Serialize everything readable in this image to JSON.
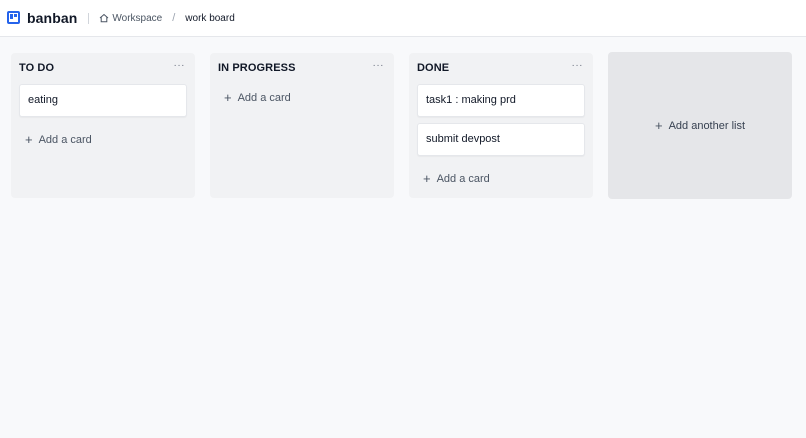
{
  "header": {
    "brand": "banban",
    "logo_icon": "board-icon",
    "breadcrumb": {
      "home_icon": "home-icon",
      "workspace": "Workspace",
      "separator": "/",
      "board": "work board"
    }
  },
  "lists": [
    {
      "title": "TO DO",
      "menu": "···",
      "cards": [
        "eating"
      ],
      "add_card": "Add a card"
    },
    {
      "title": "IN PROGRESS",
      "menu": "···",
      "cards": [],
      "add_card": "Add a card"
    },
    {
      "title": "DONE",
      "menu": "···",
      "cards": [
        "task1 : making prd",
        "submit devpost"
      ],
      "add_card": "Add a card"
    }
  ],
  "add_list": {
    "plus": "+",
    "label": "Add another list"
  },
  "colors": {
    "accent": "#2563eb",
    "background": "#f8f9fb",
    "list_bg": "#f1f2f4",
    "add_list_bg": "#e5e6e9"
  }
}
